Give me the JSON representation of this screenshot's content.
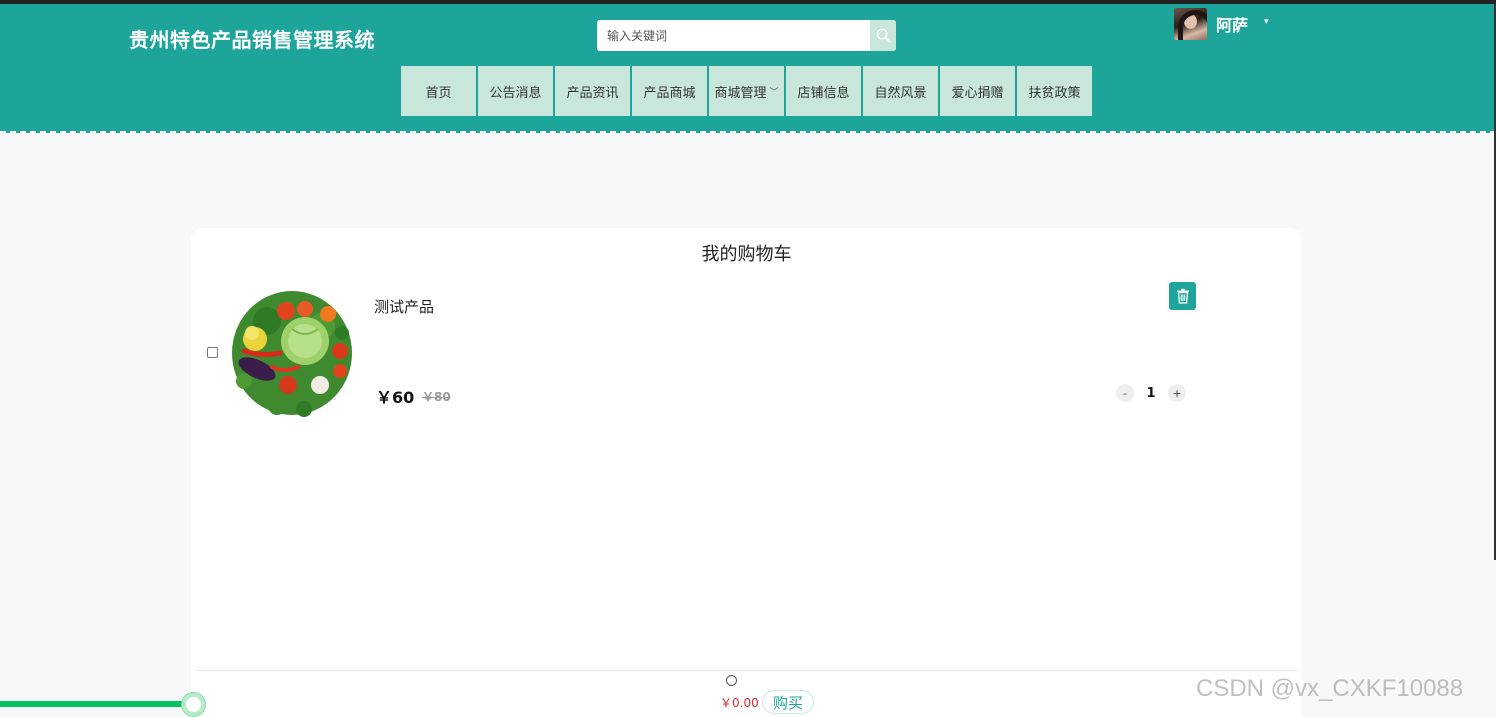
{
  "header": {
    "site_title": "贵州特色产品销售管理系统",
    "search_placeholder": "输入关键词",
    "username": "阿萨",
    "user_caret": "▾",
    "accent_color": "#1ea59b",
    "nav_bg_color": "#c8e6d9"
  },
  "nav": {
    "items": [
      {
        "label": "首页"
      },
      {
        "label": "公告消息"
      },
      {
        "label": "产品资讯"
      },
      {
        "label": "产品商城"
      },
      {
        "label": "商城管理",
        "chevron": "﹀"
      },
      {
        "label": "店铺信息"
      },
      {
        "label": "自然风景"
      },
      {
        "label": "爱心捐赠"
      },
      {
        "label": "扶贫政策"
      }
    ]
  },
  "cart": {
    "title": "我的购物车",
    "items": [
      {
        "name": "测试产品",
        "price": "￥60",
        "original_price": "￥80",
        "quantity": "1",
        "minus": "-",
        "plus": "+",
        "checked": false
      }
    ],
    "total": "￥0.00",
    "buy_label": "购买"
  },
  "progress": {
    "value_fraction": 0.13,
    "color": "#07c160"
  },
  "watermark": "CSDN @vx_CXKF10088"
}
